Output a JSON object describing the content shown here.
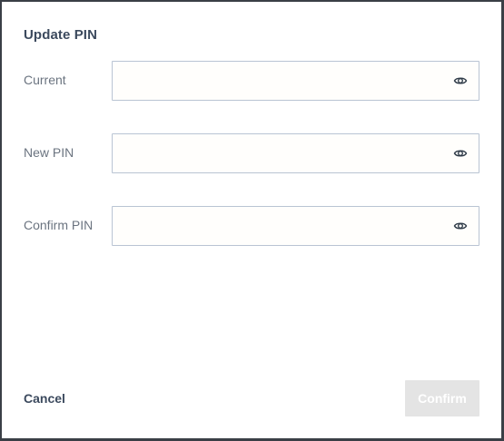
{
  "dialog": {
    "title": "Update PIN",
    "fields": [
      {
        "label": "Current",
        "value": "",
        "icon": "eye-icon"
      },
      {
        "label": "New PIN",
        "value": "",
        "icon": "eye-icon"
      },
      {
        "label": "Confirm PIN",
        "value": "",
        "icon": "eye-icon"
      }
    ],
    "cancel_label": "Cancel",
    "confirm_label": "Confirm",
    "confirm_disabled": true
  },
  "colors": {
    "title": "#3c4a5e",
    "label": "#6b7480",
    "field_border": "#b9c4d3",
    "confirm_disabled_bg": "#e4e4e4",
    "backdrop": "#3a3f46"
  }
}
